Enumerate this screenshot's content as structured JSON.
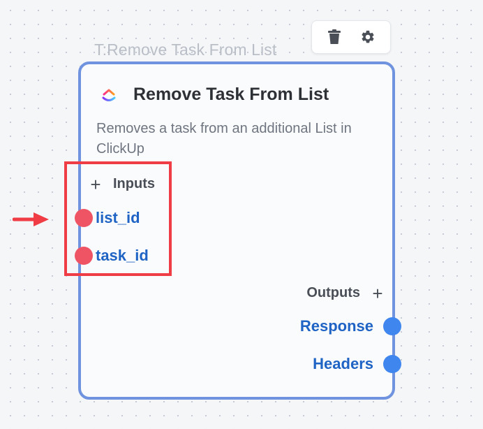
{
  "toolbar": {
    "delete_icon": "trash-icon",
    "settings_icon": "gear-icon"
  },
  "node": {
    "caption": "T:Remove Task From List",
    "title": "Remove Task From List",
    "description": "Removes a task from an additional List in ClickUp",
    "app_icon": "clickup-logo-icon",
    "inputs_label": "Inputs",
    "inputs": [
      "list_id",
      "task_id"
    ],
    "outputs_label": "Outputs",
    "outputs": [
      "Response",
      "Headers"
    ]
  },
  "colors": {
    "node_border": "#6f93de",
    "input_port": "#ef5464",
    "output_port": "#3f86ee",
    "port_label": "#1f63c5",
    "highlight": "#ef3c45"
  }
}
